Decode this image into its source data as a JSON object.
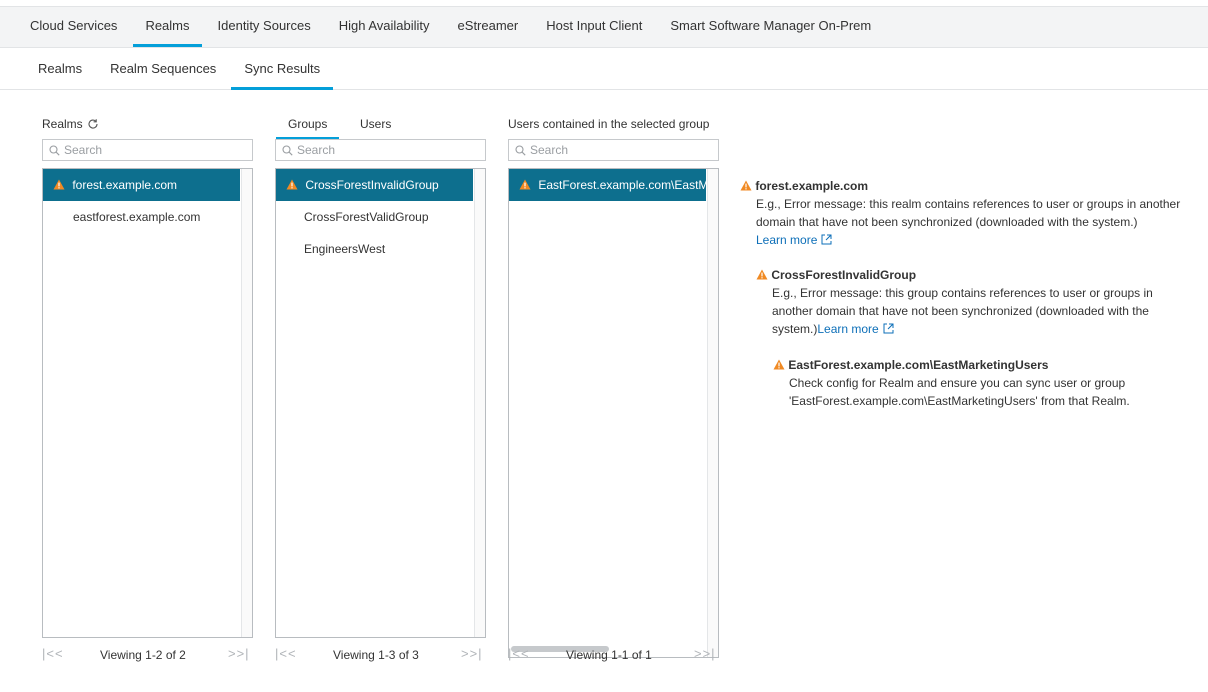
{
  "top_tabs": [
    {
      "label": "Cloud Services"
    },
    {
      "label": "Realms"
    },
    {
      "label": "Identity Sources"
    },
    {
      "label": "High Availability"
    },
    {
      "label": "eStreamer"
    },
    {
      "label": "Host Input Client"
    },
    {
      "label": "Smart Software Manager On-Prem"
    }
  ],
  "sub_tabs": [
    {
      "label": "Realms"
    },
    {
      "label": "Realm Sequences"
    },
    {
      "label": "Sync Results"
    }
  ],
  "realms": {
    "header": "Realms",
    "search_placeholder": "Search",
    "items": [
      {
        "label": "forest.example.com"
      },
      {
        "label": "eastforest.example.com"
      }
    ],
    "pager": "Viewing 1-2 of 2"
  },
  "groups": {
    "tabs": [
      {
        "label": "Groups"
      },
      {
        "label": "Users"
      }
    ],
    "search_placeholder": "Search",
    "items": [
      {
        "label": "CrossForestInvalidGroup"
      },
      {
        "label": "CrossForestValidGroup"
      },
      {
        "label": "EngineersWest"
      }
    ],
    "pager": "Viewing 1-3 of 3"
  },
  "users": {
    "header": "Users contained in the selected group",
    "search_placeholder": "Search",
    "items": [
      {
        "label": "EastForest.example.com\\EastMarketingUsers"
      }
    ],
    "pager": "Viewing 1-1 of 1"
  },
  "details": {
    "realm": {
      "title": "forest.example.com",
      "message": "E.g., Error message: this realm contains references to user or groups in another domain that have not been synchronized (downloaded with the system.)",
      "link": "Learn more"
    },
    "group": {
      "title": "CrossForestInvalidGroup",
      "message": "E.g., Error message: this group contains references to user or groups in another domain that have not been synchronized (downloaded with the system.)",
      "link": "Learn more"
    },
    "user": {
      "title": "EastForest.example.com\\EastMarketingUsers",
      "message": "Check config for Realm and ensure you can sync user or group 'EastForest.example.com\\EastMarketingUsers' from that Realm."
    }
  },
  "colors": {
    "accent": "#049fd9",
    "selected": "#0d6f8e",
    "warning": "#f08a24",
    "link": "#0d6fb8"
  }
}
